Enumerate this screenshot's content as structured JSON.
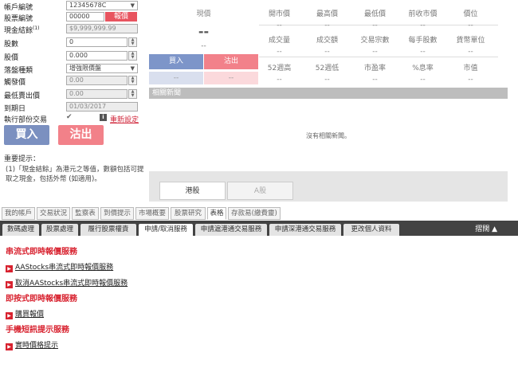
{
  "form": {
    "account_label": "帳戶編號",
    "account_value": "12345678C",
    "stock_code_label": "股票編號",
    "stock_code_value": "00000",
    "quote_button": "報價",
    "cash_label": "現金結餘",
    "cash_sup": "(1)",
    "cash_value": "$9,999,999.99",
    "lots_label": "股數",
    "lots_value": "0",
    "price_label": "股價",
    "price_value": "0.000",
    "order_type_label": "落盤種類",
    "order_type_value": "增強限價盤",
    "trigger_label": "觸發價",
    "trigger_value": "0.00",
    "min_sell_label": "最低賣出價",
    "min_sell_value": "0.00",
    "expiry_label": "到期日",
    "expiry_value": "01/03/2017",
    "partial_label": "執行部份交易",
    "partial_checked": "✔",
    "info_icon": "i",
    "reset_link": "重新設定",
    "buy_button": "買入",
    "sell_button": "沽出",
    "reminder_title": "重要提示：",
    "reminder_note": "(1)「現金結餘」為港元之等值，數額包括可提取之現金，包括外幣 (如適用)。"
  },
  "quote": {
    "price_label": "現價",
    "price_value": "--",
    "price_change": "--",
    "buy_label": "買入",
    "sell_label": "沽出",
    "buy_value": "--",
    "sell_value": "--",
    "row1_headers": [
      "開市價",
      "最高價",
      "最低價",
      "前收市價",
      "價位"
    ],
    "row1_values": [
      "--",
      "--",
      "--",
      "--",
      "--"
    ],
    "row2_headers": [
      "成交量",
      "成交額",
      "交易宗數",
      "每手股數",
      "貨幣單位"
    ],
    "row2_values": [
      "--",
      "--",
      "--",
      "--",
      "--"
    ],
    "row3_headers": [
      "52週高",
      "52週低",
      "市盈率",
      "%息率",
      "市值"
    ],
    "row3_values": [
      "--",
      "--",
      "--",
      "--",
      "--"
    ],
    "news_title": "相關新聞",
    "no_news": "沒有相關新聞。",
    "market_tabs": [
      "港股",
      "A股"
    ]
  },
  "nav1": [
    "我的帳戶",
    "交易狀況",
    "監察表",
    "到價提示",
    "市場概要",
    "股票研究",
    "表格",
    "存款易(繳費靈)"
  ],
  "nav1_active": "表格",
  "nav2": [
    "數碼處理",
    "股票處理",
    "履行股票權責",
    "申請/取消服務",
    "申請滬港通交易服務",
    "申請深港通交易服務",
    "更改個人資料"
  ],
  "nav2_active": "申請/取消服務",
  "collapse_label": "摺闊 ▲",
  "services": {
    "streaming_title": "串流式即時報價服務",
    "streaming_items": [
      "AAStocks串流式即時報價服務",
      "取消AAStocks串流式即時報價服務"
    ],
    "click_title": "即按式即時報價服務",
    "click_items": [
      "購買報價"
    ],
    "sms_title": "手機短訊提示服務",
    "sms_items": [
      "實時價格提示"
    ]
  },
  "colors": {
    "accent_red": "#d8222f",
    "buy_blue": "#7b90c0",
    "sell_pink": "#f28189",
    "dark_nav": "#434343"
  }
}
